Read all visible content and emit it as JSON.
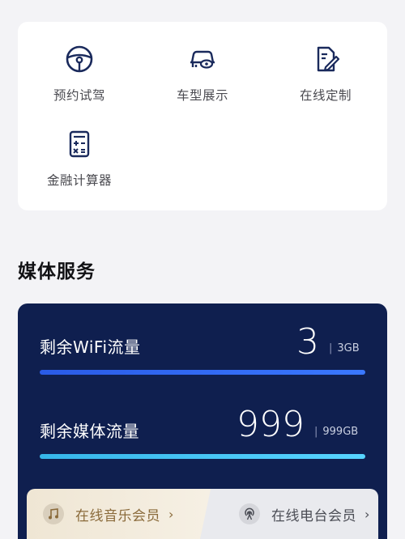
{
  "services": {
    "items": [
      {
        "label": "预约试驾",
        "icon": "steering-wheel-icon"
      },
      {
        "label": "车型展示",
        "icon": "car-view-icon"
      },
      {
        "label": "在线定制",
        "icon": "customize-document-icon"
      },
      {
        "label": "金融计算器",
        "icon": "calculator-icon"
      }
    ]
  },
  "media": {
    "title": "媒体服务",
    "wifi": {
      "label": "剩余WiFi流量",
      "value": "3",
      "unit": "3GB",
      "separator": "|"
    },
    "media_traffic": {
      "label": "剩余媒体流量",
      "value": "999",
      "unit": "999GB",
      "separator": "|"
    }
  },
  "membership": {
    "music": {
      "label": "在线音乐会员",
      "chevron": "›",
      "icon": "music-note-icon"
    },
    "radio": {
      "label": "在线电台会员",
      "chevron": "›",
      "icon": "radio-broadcast-icon"
    }
  },
  "colors": {
    "media_card_bg": "#0f1f4f",
    "wifi_bar": "#2a5be6",
    "media_bar": "#36b6ea",
    "icon_stroke": "#1a2a5c"
  }
}
